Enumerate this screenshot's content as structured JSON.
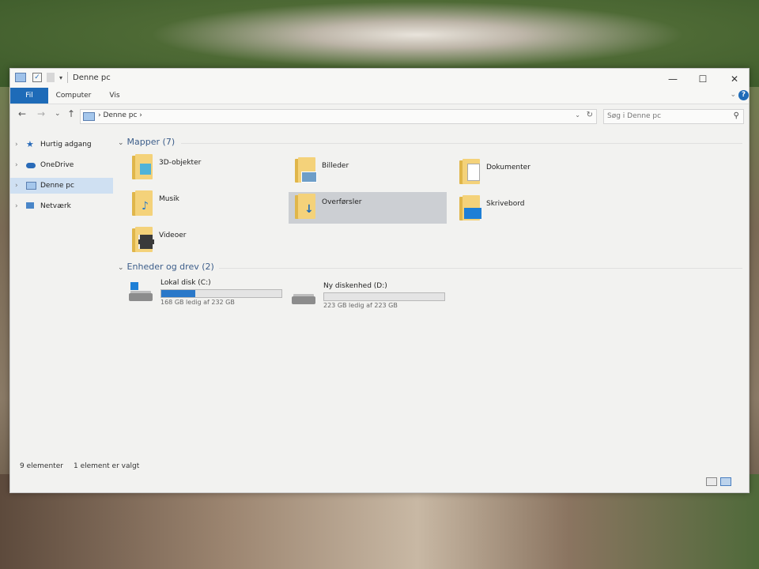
{
  "window": {
    "title": "Denne pc",
    "controls": {
      "minimize": "—",
      "maximize": "☐",
      "close": "✕"
    }
  },
  "ribbon": {
    "tabs": [
      {
        "label": "Fil",
        "active": true
      },
      {
        "label": "Computer"
      },
      {
        "label": "Vis"
      }
    ],
    "help": "?"
  },
  "navigation": {
    "back": "←",
    "forward": "→",
    "recent": "⌄",
    "up": "↑"
  },
  "address": {
    "path": "›  Denne pc  ›"
  },
  "search": {
    "placeholder": "Søg i Denne pc"
  },
  "sidebar": {
    "items": [
      {
        "label": "Hurtig adgang",
        "icon": "star-icon"
      },
      {
        "label": "OneDrive",
        "icon": "cloud-icon"
      },
      {
        "label": "Denne pc",
        "icon": "computer-icon",
        "selected": true
      },
      {
        "label": "Netværk",
        "icon": "network-icon"
      }
    ]
  },
  "folders": {
    "header": "Mapper (7)",
    "items": [
      {
        "label": "3D-objekter",
        "icon": "3d-objects-folder-icon"
      },
      {
        "label": "Billeder",
        "icon": "pictures-folder-icon"
      },
      {
        "label": "Dokumenter",
        "icon": "documents-folder-icon"
      },
      {
        "label": "Musik",
        "icon": "music-folder-icon"
      },
      {
        "label": "Overførsler",
        "icon": "downloads-folder-icon",
        "selected": true
      },
      {
        "label": "Skrivebord",
        "icon": "desktop-folder-icon"
      },
      {
        "label": "Videoer",
        "icon": "videos-folder-icon"
      }
    ]
  },
  "drives": {
    "header": "Enheder og drev (2)",
    "items": [
      {
        "label": "Lokal disk (C:)",
        "free": "168 GB ledig af 232 GB",
        "used_fraction": 0.28,
        "icon": "windows-drive-icon"
      },
      {
        "label": "Ny diskenhed (D:)",
        "free": "223 GB ledig af 223 GB",
        "used_fraction": 0.0,
        "icon": "drive-icon"
      }
    ]
  },
  "status": {
    "count": "9 elementer",
    "selection": "1 element er valgt"
  },
  "colors": {
    "accent": "#1e6bb8",
    "selection": "#cfe0f2",
    "folder": "#f4d27a",
    "bar_fill": "#2a78c9"
  }
}
